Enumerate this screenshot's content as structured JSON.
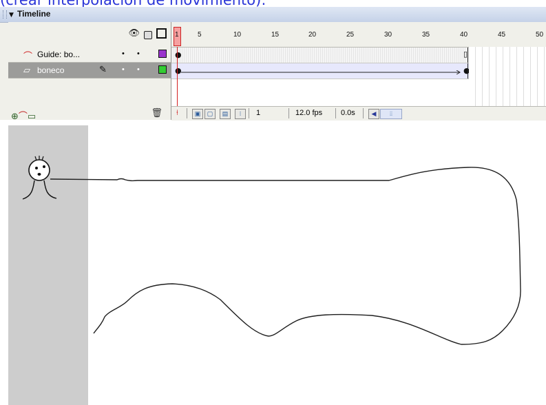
{
  "caption": "(crear interpolación de movimiento):",
  "timeline": {
    "title": "Timeline",
    "ruler_ticks": [
      "1",
      "5",
      "10",
      "15",
      "20",
      "25",
      "30",
      "35",
      "40",
      "45",
      "50"
    ],
    "layers": [
      {
        "name": "Guide: bo...",
        "icon": "guide-layer-icon",
        "color": "#9933cc"
      },
      {
        "name": "boneco",
        "icon": "layer-icon",
        "color": "#33cc33"
      }
    ],
    "current_frame": "1",
    "frame_rate": "12.0 fps",
    "elapsed_time": "0.0s"
  }
}
